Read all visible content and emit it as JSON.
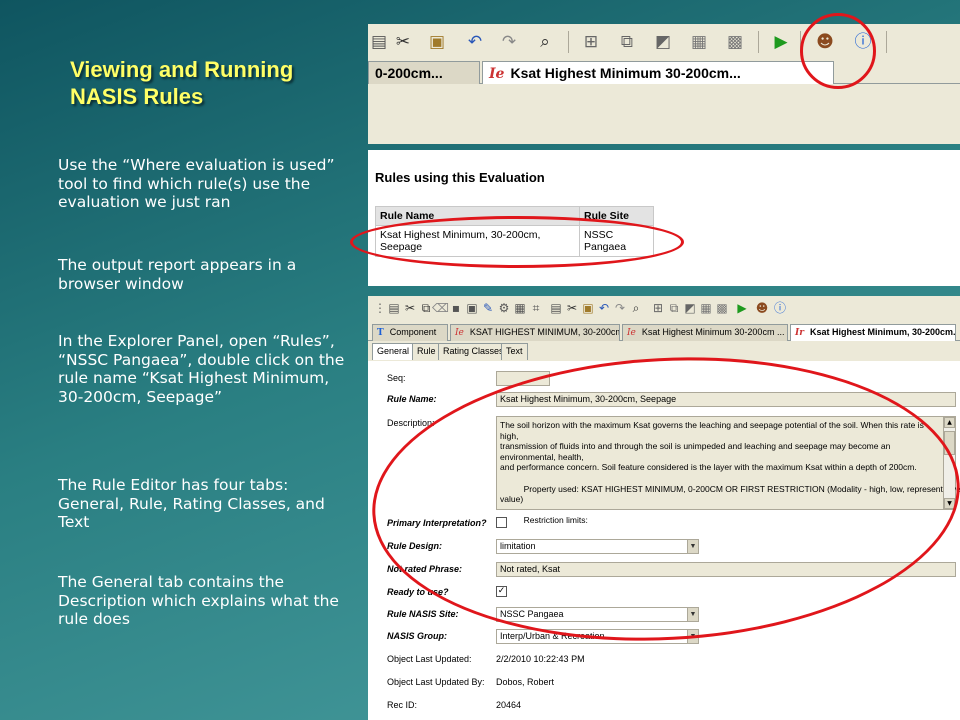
{
  "slide": {
    "title": "Viewing and Running NASIS Rules",
    "bullets": [
      "Use the “Where evaluation is used” tool to find which rule(s) use the evaluation we just ran",
      "The output report appears in a browser window",
      " In the Explorer Panel, open “Rules”, “NSSC Pangaea”, double click on the rule name “Ksat Highest Minimum, 30-200cm, Seepage”",
      "The Rule Editor has four tabs: General, Rule, Rating Classes, and Text",
      "The General tab contains the Description which explains what the rule does"
    ]
  },
  "toolbar_shot": {
    "icons": [
      "paste-icon",
      "cut-icon",
      "copy-icon",
      "undo-icon",
      "redo-icon",
      "find-icon",
      "new-record-icon",
      "link-icon",
      "import-icon",
      "export-icon",
      "batch-icon",
      "run-icon",
      "where-used-icon",
      "info-icon"
    ],
    "tabs": {
      "partial": "0-200cm...",
      "active_glyph": "Ie",
      "active": "Ksat Highest Minimum 30-200cm..."
    }
  },
  "report": {
    "heading": "Rules using this Evaluation",
    "columns": [
      "Rule Name",
      "Rule Site"
    ],
    "rows": [
      [
        "Ksat Highest Minimum, 30-200cm, Seepage",
        "NSSC Pangaea"
      ]
    ]
  },
  "editor": {
    "tabs": [
      {
        "glyph": "T",
        "label": "Component"
      },
      {
        "glyph": "Ie",
        "label": "KSAT HIGHEST MINIMUM, 30-200cm..."
      },
      {
        "glyph": "Ie",
        "label": "Ksat Highest Minimum 30-200cm ..."
      },
      {
        "glyph": "Ir",
        "label": "Ksat Highest Minimum, 30-200cm..."
      }
    ],
    "subtabs": [
      "General",
      "Rule",
      "Rating Classes",
      "Text"
    ],
    "fields": {
      "seq_label": "Seq:",
      "rule_name_label": "Rule Name:",
      "rule_name": "Ksat Highest Minimum, 30-200cm, Seepage",
      "description_label": "Description:",
      "description_lines": [
        "The soil horizon with the maximum Ksat governs the leaching and seepage potential of the soil.  When this rate is high,",
        "transmission of fluids into and through the soil is unimpeded and leaching and seepage may become an environmental, health,",
        "and performance concern.  Soil feature considered is the layer with the maximum Ksat within a depth of 200cm.",
        "",
        "          Property used: KSAT HIGHEST MINIMUM, 0-200CM OR FIRST RESTRICTION (Modality - high, low, representative",
        "value)",
        "",
        "          Restriction limits:"
      ],
      "primary_label": "Primary Interpretation?",
      "rule_design_label": "Rule Design:",
      "rule_design": "limitation",
      "not_rated_label": "Not rated Phrase:",
      "not_rated": "Not rated, Ksat",
      "ready_label": "Ready to use?",
      "site_label": "Rule NASIS Site:",
      "site": "NSSC Pangaea",
      "group_label": "NASIS Group:",
      "group": "Interp/Urban & Recreation",
      "updated_label": "Object Last Updated:",
      "updated": "2/2/2010 10:22:43 PM",
      "updated_by_label": "Object Last Updated By:",
      "updated_by": "Dobos, Robert",
      "rec_id_label": "Rec ID:",
      "rec_id": "20464"
    }
  },
  "colors": {
    "title": "#ffff66",
    "annotation_red": "#e0161b",
    "xp_face": "#ece9d8"
  }
}
